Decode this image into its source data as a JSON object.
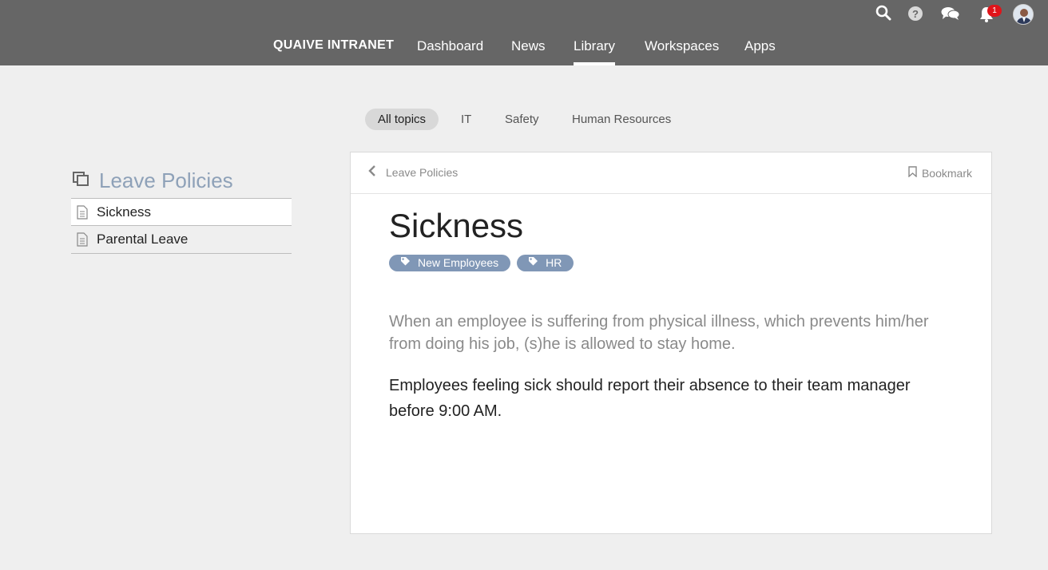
{
  "topbar": {
    "brand": "QUAIVE INTRANET",
    "nav": [
      "Dashboard",
      "News",
      "Library",
      "Workspaces",
      "Apps"
    ],
    "active_nav": "Library",
    "notification_count": "1",
    "icons": [
      "search-icon",
      "help-icon",
      "chat-icon",
      "bell-icon",
      "avatar"
    ]
  },
  "topics": [
    "All topics",
    "IT",
    "Safety",
    "Human Resources"
  ],
  "sidebar": {
    "title": "Leave Policies",
    "items": [
      {
        "label": "Sickness"
      },
      {
        "label": "Parental Leave"
      }
    ]
  },
  "card": {
    "back_label": "Leave Policies",
    "bookmark_label": "Bookmark",
    "title": "Sickness",
    "tags": [
      "New Employees",
      "HR"
    ],
    "lead": "When an employee is suffering from physical illness, which prevents him/her from doing his job, (s)he is allowed to stay home.",
    "body": "Employees feeling sick should report their absence to their team manager before 9:00 AM."
  },
  "colors": {
    "topbar": "#666666",
    "tag": "#8097b6",
    "sidebar_title": "#8ea1b8",
    "badge": "#e0141a"
  }
}
